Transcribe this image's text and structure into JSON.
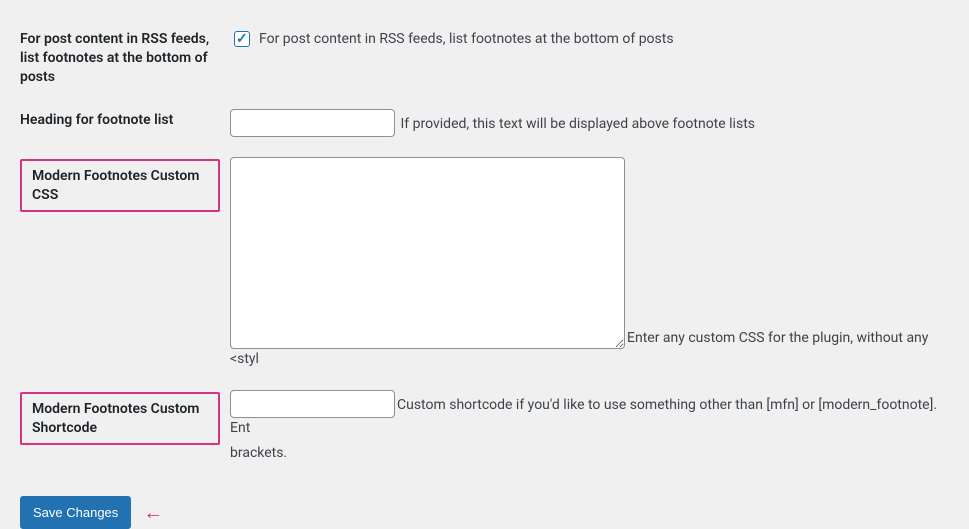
{
  "rows": {
    "rss": {
      "label": "For post content in RSS feeds, list footnotes at the bottom of posts",
      "checkbox_label": "For post content in RSS feeds, list footnotes at the bottom of posts",
      "checked": true
    },
    "heading": {
      "label": "Heading for footnote list",
      "value": "",
      "desc": "If provided, this text will be displayed above footnote lists"
    },
    "css": {
      "label": "Modern Footnotes Custom CSS",
      "value": "",
      "desc": "Enter any custom CSS for the plugin, without any <styl"
    },
    "shortcode": {
      "label": "Modern Footnotes Custom Shortcode",
      "value": "",
      "desc_line1": "Custom shortcode if you'd like to use something other than [mfn] or [modern_footnote]. Ent",
      "desc_line2": "brackets."
    }
  },
  "submit": {
    "label": "Save Changes"
  }
}
